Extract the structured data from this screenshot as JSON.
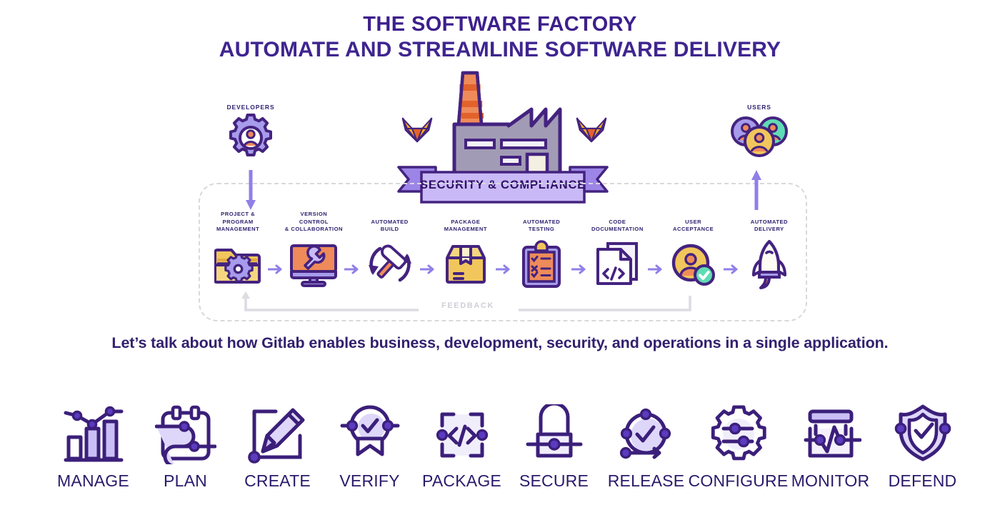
{
  "headings": {
    "title_line1": "THE SOFTWARE FACTORY",
    "title_line2": "AUTOMATE AND STREAMLINE SOFTWARE DELIVERY"
  },
  "ribbon": {
    "label": "SECURITY & COMPLIANCE"
  },
  "endpoints": {
    "left": {
      "label": "DEVELOPERS",
      "icon": "gear-user-icon"
    },
    "right": {
      "label": "USERS",
      "icon": "user-group-icon"
    }
  },
  "pipeline": {
    "feedback_label": "FEEDBACK",
    "arrow_icon": "arrow-right-icon",
    "stages": [
      {
        "label": "PROJECT & PROGRAM\nMANAGEMENT",
        "icon": "folder-gear-icon"
      },
      {
        "label": "VERSION\nCONTROL\n& COLLABORATION",
        "icon": "monitor-wrench-icon"
      },
      {
        "label": "AUTOMATED\nBUILD",
        "icon": "hammer-refresh-icon"
      },
      {
        "label": "PACKAGE\nMANAGEMENT",
        "icon": "package-box-icon"
      },
      {
        "label": "AUTOMATED\nTESTING",
        "icon": "clipboard-checklist-icon"
      },
      {
        "label": "CODE\nDOCUMENTATION",
        "icon": "code-documents-icon"
      },
      {
        "label": "USER\nACCEPTANCE",
        "icon": "user-approved-icon"
      },
      {
        "label": "AUTOMATED\nDELIVERY",
        "icon": "rocket-icon"
      }
    ]
  },
  "tagline": "Let’s talk about how Gitlab enables business, development, security, and operations in a single application.",
  "devops_stages": [
    {
      "label": "MANAGE",
      "icon": "bar-chart-trend-icon"
    },
    {
      "label": "PLAN",
      "icon": "calendar-flow-icon"
    },
    {
      "label": "CREATE",
      "icon": "pencil-edit-icon"
    },
    {
      "label": "VERIFY",
      "icon": "badge-check-icon"
    },
    {
      "label": "PACKAGE",
      "icon": "code-brackets-icon"
    },
    {
      "label": "SECURE",
      "icon": "lock-icon"
    },
    {
      "label": "RELEASE",
      "icon": "clock-check-arrow-icon"
    },
    {
      "label": "CONFIGURE",
      "icon": "gear-sliders-icon"
    },
    {
      "label": "MONITOR",
      "icon": "window-pulse-icon"
    },
    {
      "label": "DEFEND",
      "icon": "shield-check-icon"
    }
  ],
  "colors": {
    "deep_purple": "#3d1f8c",
    "indigo_text": "#2f2170",
    "outline": "#4a2a8f",
    "lilac": "#a79bec",
    "lilac_light": "#d6d0f7",
    "orange": "#ef8b5a",
    "orange_dark": "#e2622c",
    "yellow": "#f1c65c",
    "teal": "#3fc9a7",
    "grey_factory": "#a29bb5",
    "dashed_grey": "#d8d8dd",
    "feedback_grey": "#cfcfd6"
  }
}
